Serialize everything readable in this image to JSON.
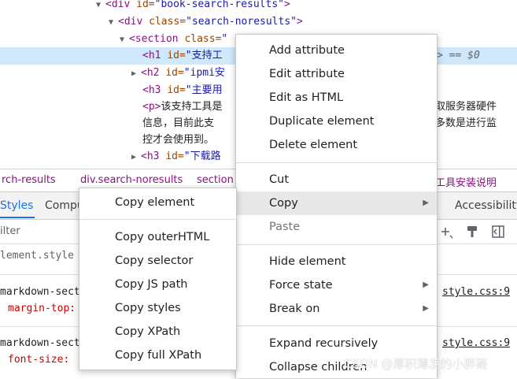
{
  "elements": {
    "lines": [
      {
        "pre": "<div ",
        "attr": "id=",
        "val": "\"book-search-results\"",
        "post": ">"
      },
      {
        "pre": "<div ",
        "attr": "class=",
        "val": "\"search-noresults\"",
        "post": ">"
      },
      {
        "pre": "<section ",
        "attr": "class=",
        "val": "\""
      },
      {
        "pre": "<h1 ",
        "attr": "id=",
        "val": "\"支持工"
      },
      {
        "pre": "<h2 ",
        "attr": "id=",
        "val": "\"ipmi安"
      },
      {
        "pre": "<h3 ",
        "attr": "id=",
        "val": "\"主要用"
      },
      {
        "pre": "<p>",
        "txt": "该支持工具是"
      },
      {
        "txt": "信息，目前此支"
      },
      {
        "txt": "控才会使用到。"
      },
      {
        "pre": "<h3 ",
        "attr": "id=",
        "val": "\"下载路"
      }
    ],
    "right_fragments": {
      "eq": "> == $0",
      "r1": "取服务器硬件",
      "r2": "多数是进行监"
    }
  },
  "breadcrumb": {
    "items": [
      "rch-results",
      "div.search-noresults",
      "section"
    ],
    "right": "工具安装说明"
  },
  "tabs": {
    "styles": "Styles",
    "computed": "Compu",
    "accessibility": "Accessibility"
  },
  "filter": {
    "placeholder": "ilter"
  },
  "styles_panel": {
    "element_style": "lement.style",
    "rule1_selector": "markdown-sect",
    "rule1_prop": "margin-top:",
    "rule1_source": "style.css:9",
    "rule2_selector": "markdown-sect",
    "rule2_prop": "font-size:",
    "rule2_source": "style.css:9"
  },
  "main_menu": {
    "items": [
      {
        "label": "Add attribute"
      },
      {
        "label": "Edit attribute"
      },
      {
        "label": "Edit as HTML"
      },
      {
        "label": "Duplicate element"
      },
      {
        "label": "Delete element"
      },
      {
        "label": "Cut"
      },
      {
        "label": "Copy"
      },
      {
        "label": "Paste"
      },
      {
        "label": "Hide element"
      },
      {
        "label": "Force state"
      },
      {
        "label": "Break on"
      },
      {
        "label": "Expand recursively"
      },
      {
        "label": "Collapse children"
      }
    ]
  },
  "copy_menu": {
    "items": [
      {
        "label": "Copy element"
      },
      {
        "label": "Copy outerHTML"
      },
      {
        "label": "Copy selector"
      },
      {
        "label": "Copy JS path"
      },
      {
        "label": "Copy styles"
      },
      {
        "label": "Copy XPath"
      },
      {
        "label": "Copy full XPath"
      }
    ]
  },
  "watermark": "CSDN @厚积薄发的小胖砸",
  "colors": {
    "tag": "#881280",
    "attr": "#994500",
    "value": "#1a1aa6",
    "selection": "#cfe8fc",
    "accent": "#1a73e8"
  }
}
